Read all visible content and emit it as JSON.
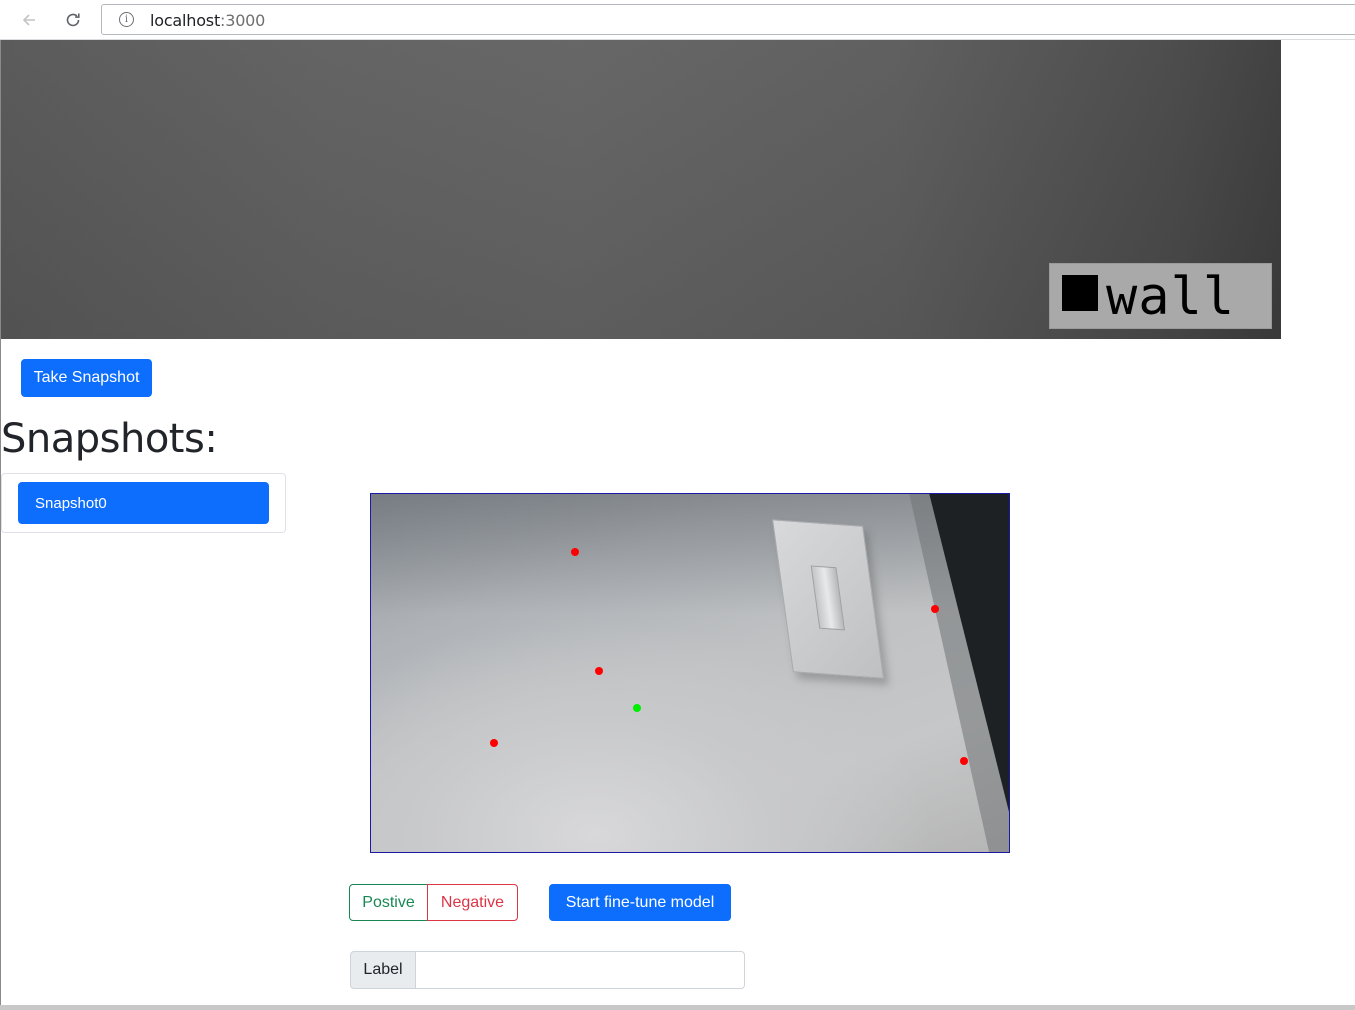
{
  "browser": {
    "url_host": "localhost",
    "url_port": ":3000"
  },
  "webcam": {
    "prediction_label": "wall"
  },
  "actions": {
    "take_snapshot_label": "Take Snapshot"
  },
  "snapshots": {
    "heading": "Snapshots:",
    "items": [
      {
        "label": "Snapshot0",
        "selected": true
      }
    ]
  },
  "annotation": {
    "positive_label": "Postive",
    "negative_label": "Negative",
    "finetune_label": "Start fine-tune model",
    "negative_point_color": "#ff0000",
    "positive_point_color": "#00ee00"
  },
  "label_input": {
    "addon": "Label",
    "value": ""
  },
  "colors": {
    "primary": "#0d6efd",
    "success": "#198754",
    "danger": "#dc3545"
  }
}
